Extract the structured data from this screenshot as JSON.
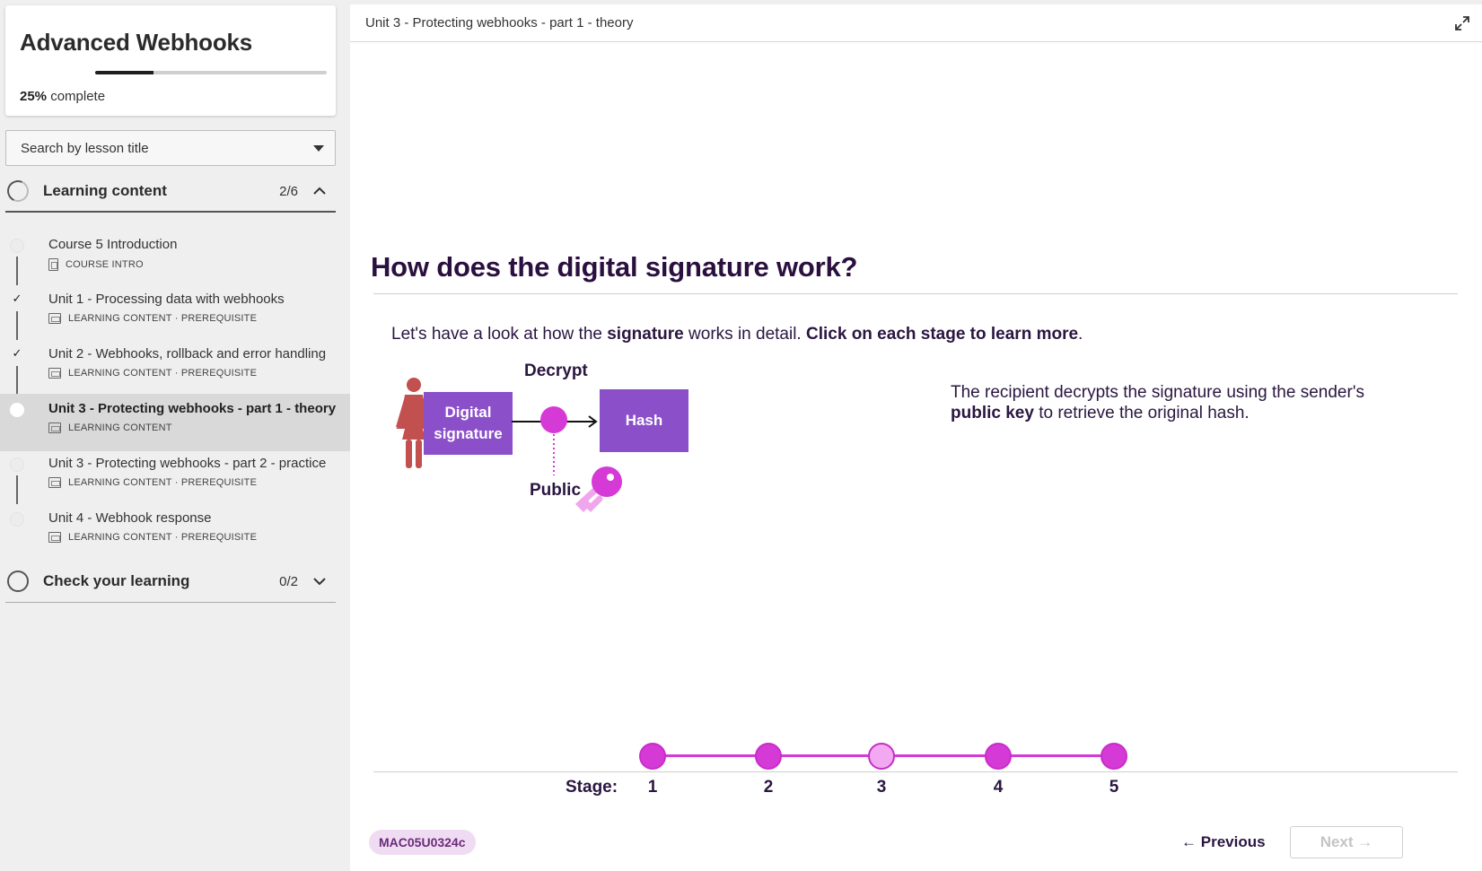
{
  "course": {
    "title": "Advanced Webhooks",
    "progress_percent": 25,
    "progress_value": "25%",
    "progress_suffix": "complete"
  },
  "search": {
    "placeholder": "Search by lesson title"
  },
  "sections": [
    {
      "title": "Learning content",
      "count": "2/6",
      "expanded": true,
      "lessons": [
        {
          "title": "Course 5 Introduction",
          "meta": "COURSE INTRO",
          "icon": "document-icon",
          "status": "incomplete"
        },
        {
          "title": "Unit 1 - Processing data with webhooks",
          "meta": "LEARNING CONTENT · PREREQUISITE",
          "icon": "video-icon",
          "status": "complete"
        },
        {
          "title": "Unit 2 - Webhooks, rollback and error handling",
          "meta": "LEARNING CONTENT · PREREQUISITE",
          "icon": "video-icon",
          "status": "complete"
        },
        {
          "title": "Unit 3 - Protecting webhooks - part 1 - theory",
          "meta": "LEARNING CONTENT",
          "icon": "video-icon",
          "status": "active"
        },
        {
          "title": "Unit 3 - Protecting webhooks - part 2 - practice",
          "meta": "LEARNING CONTENT · PREREQUISITE",
          "icon": "video-icon",
          "status": "incomplete"
        },
        {
          "title": "Unit 4 - Webhook response",
          "meta": "LEARNING CONTENT · PREREQUISITE",
          "icon": "video-icon",
          "status": "incomplete"
        }
      ]
    },
    {
      "title": "Check your learning",
      "count": "0/2",
      "expanded": false
    }
  ],
  "main": {
    "breadcrumb": "Unit 3 - Protecting webhooks - part 1 - theory",
    "heading": "How does the digital signature work?",
    "intro": {
      "a": "Let's have a look at how the ",
      "b": "signature",
      "c": " works in detail. ",
      "d": "Click on each stage to learn more",
      "e": "."
    },
    "diagram": {
      "decrypt_label": "Decrypt",
      "box1_line1": "Digital",
      "box1_line2": "signature",
      "box2": "Hash",
      "public_label": "Public"
    },
    "explanation": {
      "a": "The recipient decrypts the signature using the sender's ",
      "b": "public key",
      "c": " to retrieve the original hash."
    },
    "stages": {
      "label": "Stage:",
      "items": [
        "1",
        "2",
        "3",
        "4",
        "5"
      ],
      "current": 3
    },
    "code": "MAC05U0324c",
    "prev_label": "Previous",
    "next_label": "Next"
  },
  "colors": {
    "accent": "#d63ad6",
    "box": "#8b4fc9",
    "heading": "#2a0f3f",
    "person": "#c2504e"
  }
}
